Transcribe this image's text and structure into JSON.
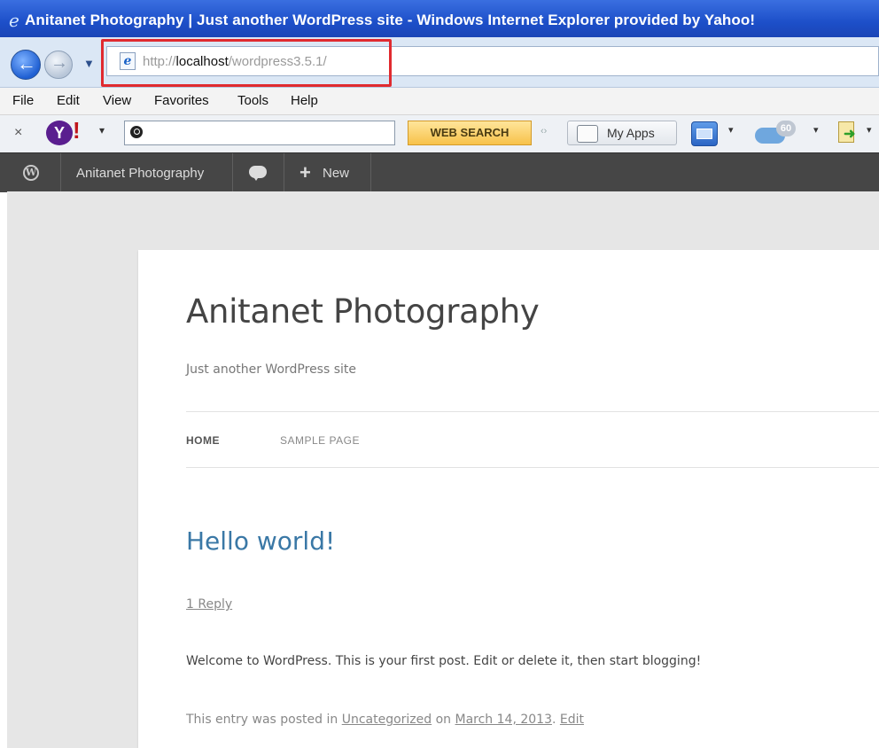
{
  "window": {
    "title": "Anitanet Photography | Just another WordPress site - Windows Internet Explorer provided by Yahoo!"
  },
  "address_bar": {
    "url_prefix": "http://",
    "url_host": "localhost",
    "url_path": "/wordpress3.5.1/",
    "highlight_color": "#e02a2f"
  },
  "menu": {
    "items": [
      "File",
      "Edit",
      "View",
      "Favorites",
      "Tools",
      "Help"
    ]
  },
  "yahoo_toolbar": {
    "close": "×",
    "logo_letter": "Y",
    "logo_bang": "!",
    "dropdown": "▾",
    "web_search_label": "WEB SEARCH",
    "grip": "‹›",
    "my_apps_label": "My Apps",
    "weather_badge": "60"
  },
  "admin_bar": {
    "wp_logo": "W",
    "site_name": "Anitanet Photography",
    "new_plus": "+",
    "new_label": "New"
  },
  "site": {
    "title": "Anitanet Photography",
    "description": "Just another WordPress site",
    "nav": [
      "HOME",
      "SAMPLE PAGE"
    ]
  },
  "post": {
    "title": "Hello world!",
    "reply_link": "1 Reply",
    "body": "Welcome to WordPress. This is your first post. Edit or delete it, then start blogging!",
    "meta_prefix": "This entry was posted in ",
    "category": "Uncategorized",
    "meta_on": " on ",
    "date": "March 14, 2013",
    "meta_sep": ". ",
    "edit": "Edit"
  },
  "colors": {
    "titlebar": "#1d4fc9",
    "adminbar": "#464646",
    "post_title": "#3a78a6",
    "page_bg": "#e6e6e6"
  }
}
